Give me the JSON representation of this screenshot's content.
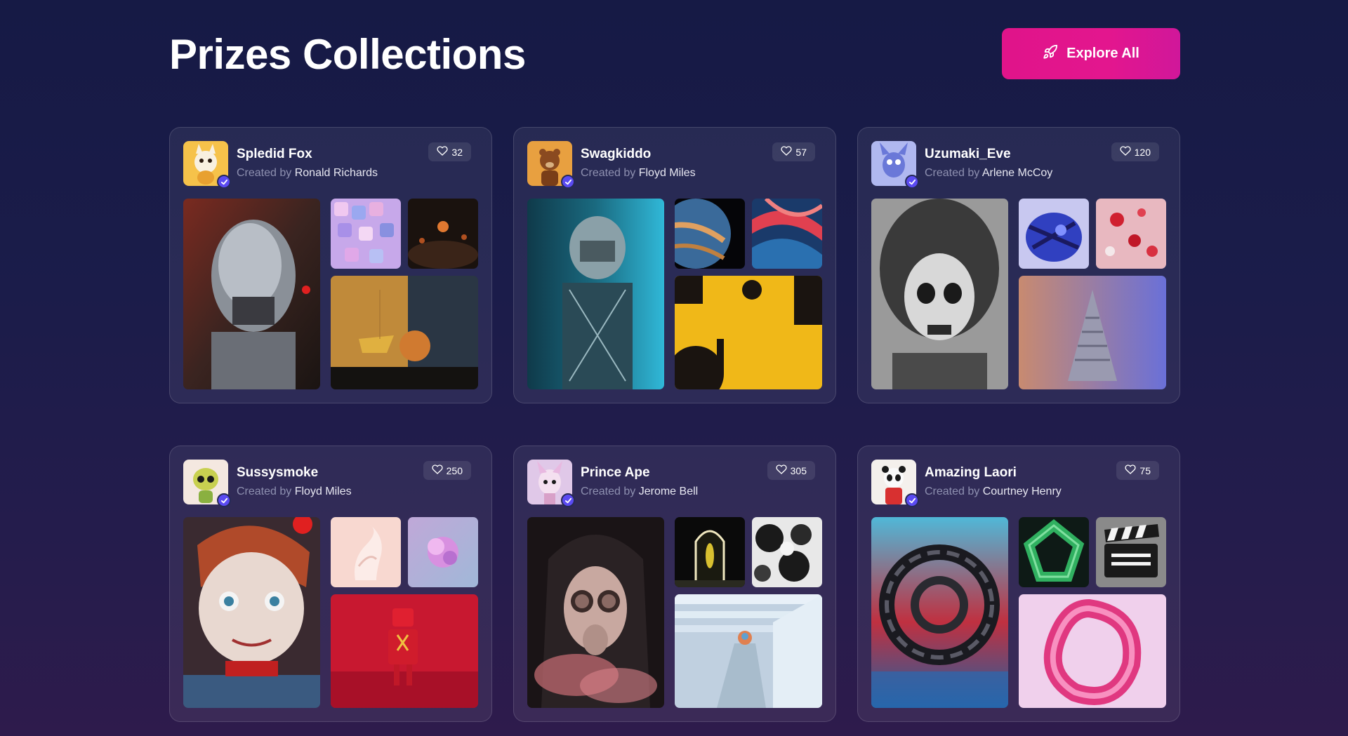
{
  "header": {
    "title": "Prizes Collections",
    "explore_button_label": "Explore All",
    "explore_icon": "rocket-icon"
  },
  "colors": {
    "accent": "#e0148a",
    "verified": "#5b4bf2",
    "background": "#1b1c4a"
  },
  "created_by_prefix": "Created by",
  "collections": [
    {
      "name": "Spledid Fox",
      "creator": "Ronald Richards",
      "likes": "32"
    },
    {
      "name": "Swagkiddo",
      "creator": "Floyd Miles",
      "likes": "57"
    },
    {
      "name": "Uzumaki_Eve",
      "creator": "Arlene McCoy",
      "likes": "120"
    },
    {
      "name": "Sussysmoke",
      "creator": "Floyd Miles",
      "likes": "250"
    },
    {
      "name": "Prince Ape",
      "creator": "Jerome Bell",
      "likes": "305"
    },
    {
      "name": "Amazing Laori",
      "creator": "Courtney Henry",
      "likes": "75"
    }
  ]
}
